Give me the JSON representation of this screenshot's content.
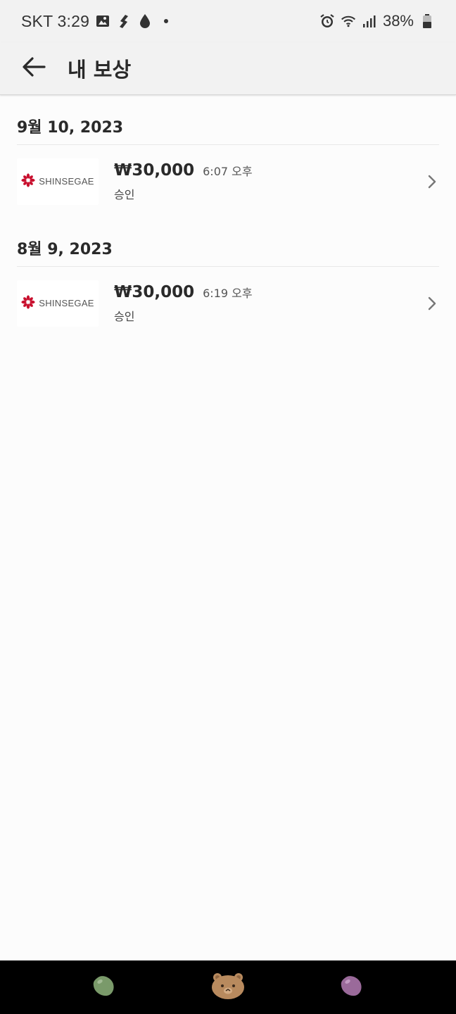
{
  "status_bar": {
    "carrier_time": "SKT 3:29",
    "battery": "38%",
    "icons": [
      "gallery-icon",
      "fitness-icon",
      "water-drop-icon",
      "dot-icon",
      "alarm-icon",
      "wifi-icon",
      "signal-icon",
      "battery-icon"
    ]
  },
  "header": {
    "back_icon": "arrow-left-icon",
    "title": "내 보상"
  },
  "groups": [
    {
      "date": "9월 10, 2023",
      "items": [
        {
          "brand": "SHINSEGAE",
          "amount": "₩30,000",
          "time": "6:07 오후",
          "status": "승인"
        }
      ]
    },
    {
      "date": "8월 9, 2023",
      "items": [
        {
          "brand": "SHINSEGAE",
          "amount": "₩30,000",
          "time": "6:19 오후",
          "status": "승인"
        }
      ]
    }
  ],
  "colors": {
    "brand_red": "#c8102e",
    "background": "#fcfcfc",
    "bar": "#f2f2f2",
    "nav_green": "#7a9a6a",
    "nav_bear": "#b88a5e",
    "nav_purple": "#9a6a9a"
  },
  "navbar": {
    "buttons": [
      "green-bean-icon",
      "bear-face-icon",
      "purple-bean-icon"
    ]
  }
}
